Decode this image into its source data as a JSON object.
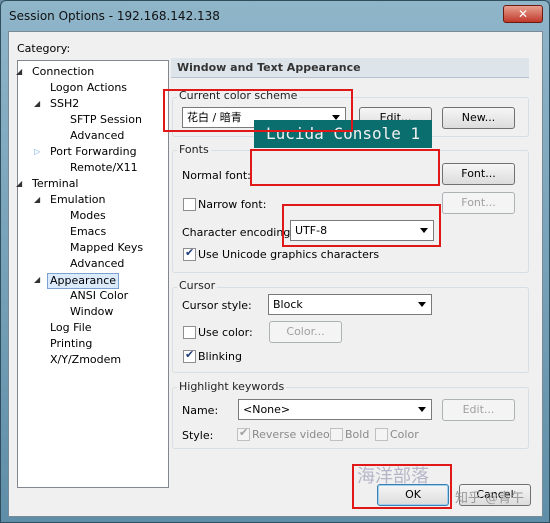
{
  "window": {
    "title": "Session Options - 192.168.142.138",
    "close_glyph": "✕"
  },
  "category_label": "Category:",
  "tree": [
    {
      "label": "Connection",
      "twisty": "◢"
    },
    {
      "label": "Logon Actions",
      "twisty": ""
    },
    {
      "label": "SSH2",
      "twisty": "◢"
    },
    {
      "label": "SFTP Session",
      "twisty": ""
    },
    {
      "label": "Advanced",
      "twisty": ""
    },
    {
      "label": "Port Forwarding",
      "twisty": "▷"
    },
    {
      "label": "Remote/X11",
      "twisty": ""
    },
    {
      "label": "Terminal",
      "twisty": "◢"
    },
    {
      "label": "Emulation",
      "twisty": "◢"
    },
    {
      "label": "Modes",
      "twisty": ""
    },
    {
      "label": "Emacs",
      "twisty": ""
    },
    {
      "label": "Mapped Keys",
      "twisty": ""
    },
    {
      "label": "Advanced",
      "twisty": ""
    },
    {
      "label": "Appearance",
      "twisty": "◢"
    },
    {
      "label": "ANSI Color",
      "twisty": ""
    },
    {
      "label": "Window",
      "twisty": ""
    },
    {
      "label": "Log File",
      "twisty": ""
    },
    {
      "label": "Printing",
      "twisty": ""
    },
    {
      "label": "X/Y/Zmodem",
      "twisty": ""
    }
  ],
  "panel_title": "Window and Text Appearance",
  "color_scheme": {
    "group": "Current color scheme",
    "value": "花白 / 暗青",
    "edit": "Edit...",
    "new": "New..."
  },
  "fonts": {
    "group": "Fonts",
    "normal_font_label": "Normal font:",
    "normal_font_preview": "Lucida Console 1",
    "font_button": "Font...",
    "narrow_font_label": "Narrow font:",
    "narrow_font_button": "Font...",
    "encoding_label": "Character encoding:",
    "encoding_value": "UTF-8",
    "unicode_label": "Use Unicode graphics characters"
  },
  "cursor": {
    "group": "Cursor",
    "style_label": "Cursor style:",
    "style_value": "Block",
    "use_color_label": "Use color:",
    "color_button": "Color...",
    "blinking_label": "Blinking"
  },
  "highlight": {
    "group": "Highlight keywords",
    "name_label": "Name:",
    "name_value": "<None>",
    "edit_button": "Edit...",
    "style_label": "Style:",
    "reverse_label": "Reverse video",
    "bold_label": "Bold",
    "color_label": "Color"
  },
  "footer": {
    "ok": "OK",
    "cancel": "Cancel"
  },
  "watermarks": {
    "top": "海洋部落",
    "bottom": "知乎 @青午"
  },
  "colors": {
    "highlight_box": "#e01818",
    "font_preview_bg": "#0b6e6e"
  }
}
